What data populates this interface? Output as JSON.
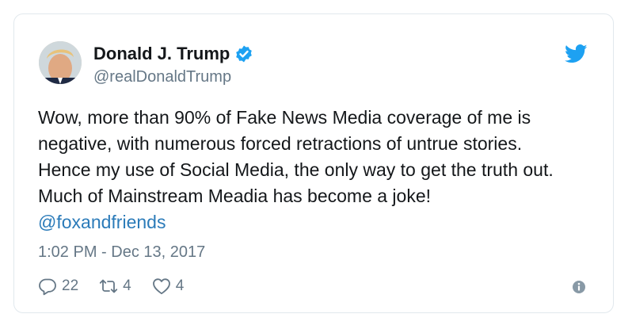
{
  "user": {
    "display_name": "Donald J. Trump",
    "handle": "@realDonaldTrump",
    "verified_icon": "verified-badge-icon"
  },
  "tweet": {
    "lines": [
      "Wow, more than 90% of Fake News Media coverage of me is",
      "negative, with numerous forced retractions of untrue stories.",
      "Hence my use of Social Media, the only way to get the truth out.",
      "Much of Mainstream Meadia has become a joke!"
    ],
    "mention": "@foxandfriends",
    "timestamp": "1:02 PM - Dec 13, 2017"
  },
  "actions": {
    "replies": "22",
    "retweets": "4",
    "likes": "4"
  },
  "icons": {
    "brand": "twitter-bird-icon",
    "reply": "reply-icon",
    "retweet": "retweet-icon",
    "like": "heart-icon",
    "info": "info-icon"
  },
  "colors": {
    "brand_blue": "#1da1f2",
    "link_blue": "#2b7bb9",
    "text": "#14171a",
    "muted": "#657786",
    "border": "#e1e8ed"
  }
}
